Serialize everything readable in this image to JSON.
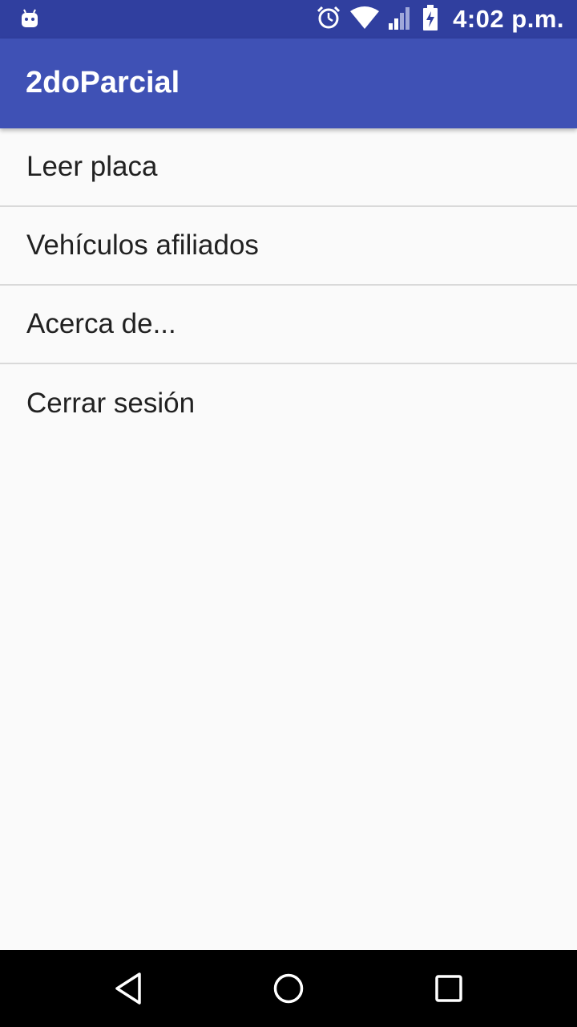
{
  "status_bar": {
    "time": "4:02 p.m.",
    "left_icon": "android-debug-icon",
    "icons": [
      "alarm-icon",
      "wifi-icon",
      "signal-icon",
      "battery-charging-icon"
    ],
    "background": "#303f9f"
  },
  "app_bar": {
    "title": "2doParcial",
    "background": "#3f51b5"
  },
  "menu": {
    "items": [
      {
        "label": "Leer placa"
      },
      {
        "label": "Vehículos afiliados"
      },
      {
        "label": "Acerca de..."
      },
      {
        "label": "Cerrar sesión"
      }
    ]
  },
  "nav_bar": {
    "buttons": [
      "back-icon",
      "home-icon",
      "recents-icon"
    ]
  }
}
